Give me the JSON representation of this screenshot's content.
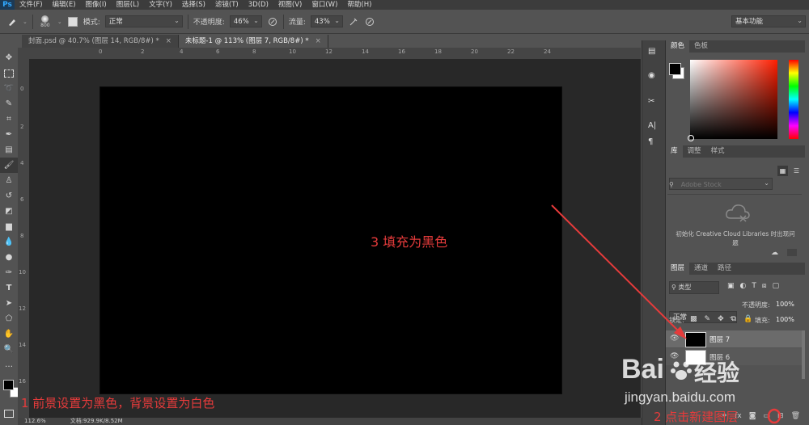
{
  "menubar": {
    "logo": "Ps",
    "items": [
      "文件(F)",
      "编辑(E)",
      "图像(I)",
      "图层(L)",
      "文字(Y)",
      "选择(S)",
      "滤镜(T)",
      "3D(D)",
      "视图(V)",
      "窗口(W)",
      "帮助(H)"
    ]
  },
  "options": {
    "brush_size": "800",
    "mode_label": "模式:",
    "mode_value": "正常",
    "opacity_label": "不透明度:",
    "opacity_value": "46%",
    "flow_label": "流量:",
    "flow_value": "43%",
    "workspace": "基本功能"
  },
  "tabs": [
    {
      "label": "封面.psd @ 40.7% (图层 14, RGB/8#) *",
      "active": false
    },
    {
      "label": "未标题-1 @ 113% (图层 7, RGB/8#) *",
      "active": true
    }
  ],
  "ruler": {
    "top_labels": [
      "0",
      "2",
      "4",
      "6",
      "8",
      "10",
      "12",
      "14",
      "16",
      "18",
      "20",
      "22",
      "24"
    ],
    "left_labels": [
      "0",
      "2",
      "4",
      "6",
      "8",
      "10",
      "12",
      "14",
      "16"
    ]
  },
  "statusbar": {
    "zoom": "112.6%",
    "doc": "文档:929.9K/8.52M"
  },
  "color_panel": {
    "tabs": [
      "颜色",
      "色板"
    ],
    "foreground": "#000000",
    "background": "#ffffff"
  },
  "library_panel": {
    "tabs": [
      "库",
      "调整",
      "样式"
    ],
    "search_placeholder": "Adobe Stock",
    "message": "初始化 Creative Cloud Libraries 时出现问题"
  },
  "layers_panel": {
    "tabs": [
      "图层",
      "通道",
      "路径"
    ],
    "filter_label": "类型",
    "blend_mode": "正常",
    "opacity_label": "不透明度:",
    "opacity_value": "100%",
    "lock_label": "锁定:",
    "fill_label": "填充:",
    "fill_value": "100%",
    "layers": [
      {
        "name": "图层 7",
        "selected": true,
        "thumb": "#000000"
      },
      {
        "name": "图层 6",
        "selected": false,
        "thumb": "#ffffff"
      }
    ]
  },
  "annotations": {
    "step1": "1 前景设置为黑色，背景设置为白色",
    "step2": "2 点击新建图层",
    "step3": "3 填充为黑色",
    "color": "#e63b3b"
  },
  "watermark": {
    "brand": "Bai",
    "brand_cn": "经验",
    "url": "jingyan.baidu.com"
  }
}
